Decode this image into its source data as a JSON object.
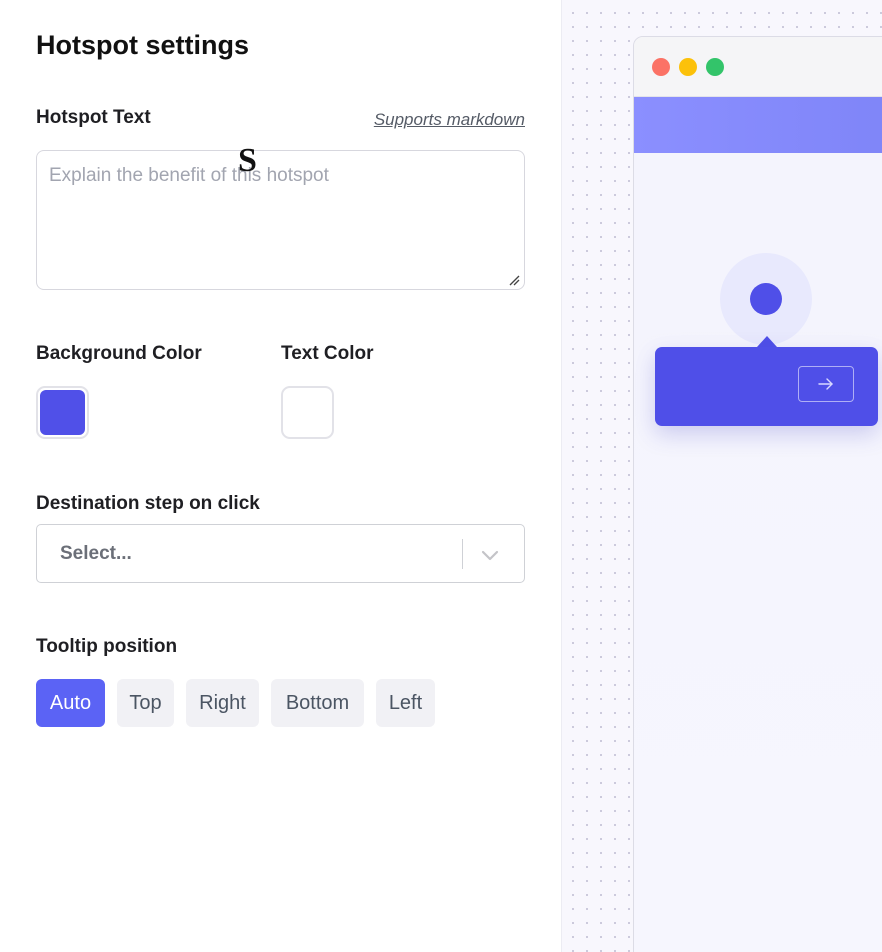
{
  "panel": {
    "title": "Hotspot settings",
    "hotspot_text": {
      "label": "Hotspot Text",
      "markdown_link": "Supports markdown",
      "placeholder": "Explain the benefit of this hotspot",
      "value": ""
    },
    "background_color": {
      "label": "Background Color",
      "value": "#5050e8"
    },
    "text_color": {
      "label": "Text Color",
      "value": "#ffffff"
    },
    "destination": {
      "label": "Destination step on click",
      "selected": "Select..."
    },
    "tooltip_position": {
      "label": "Tooltip position",
      "options": [
        "Auto",
        "Top",
        "Right",
        "Bottom",
        "Left"
      ],
      "selected": "Auto"
    }
  },
  "preview": {
    "window_dots": [
      "#fb7266",
      "#fcc10a",
      "#33c46a"
    ],
    "accent": "#4f4fe8",
    "hero_letter": "S",
    "next_icon": "arrow-right-icon"
  },
  "colors": {
    "active_button": "#5b63f5",
    "inactive_button": "#f1f1f5"
  }
}
